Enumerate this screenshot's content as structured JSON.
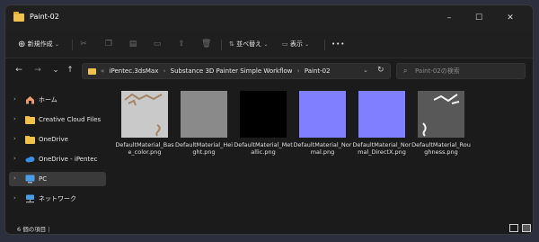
{
  "window": {
    "title": "Paint-02",
    "minimize": "–",
    "maximize": "☐",
    "close": "✕"
  },
  "toolbar": {
    "new_label": "新規作成",
    "new_icon": "⊕",
    "sort_label": "並べ替え",
    "view_label": "表示",
    "more_label": "•••",
    "dim_icons": [
      "cut-icon",
      "copy-icon",
      "paste-icon",
      "rename-icon",
      "share-icon",
      "delete-icon"
    ]
  },
  "nav": {
    "back": "←",
    "forward": "→",
    "dropdown": "⌄",
    "up": "↑"
  },
  "address": {
    "prefix": "«",
    "crumbs": [
      "iPentec.3dsMax",
      "Substance 3D Painter Simple Workflow",
      "Paint-02"
    ],
    "sep": "›",
    "dropdown": "⌄",
    "refresh": "↻"
  },
  "search": {
    "placeholder": "Paint-02の検索"
  },
  "sidebar": {
    "items": [
      {
        "label": "ホーム",
        "icon": "home-icon"
      },
      {
        "label": "Creative Cloud Files",
        "icon": "folder-icon"
      },
      {
        "label": "OneDrive",
        "icon": "folder-icon"
      },
      {
        "label": "OneDrive - iPentec",
        "icon": "cloud-icon"
      },
      {
        "label": "PC",
        "icon": "pc-icon"
      },
      {
        "label": "ネットワーク",
        "icon": "network-icon"
      }
    ]
  },
  "files": [
    {
      "name": "DefaultMaterial_Base_color.png",
      "color": "#c9c9c9"
    },
    {
      "name": "DefaultMaterial_Height.png",
      "color": "#8a8a8a"
    },
    {
      "name": "DefaultMaterial_Metallic.png",
      "color": "#000000"
    },
    {
      "name": "DefaultMaterial_Normal.png",
      "color": "#7f7fff"
    },
    {
      "name": "DefaultMaterial_Normal_DirectX.png",
      "color": "#7f7fff"
    },
    {
      "name": "DefaultMaterial_Roughness.png",
      "color": "#585858"
    }
  ],
  "status": {
    "text": "6 個の項目"
  },
  "colors": {
    "accent": "#4a90e2",
    "folder": "#f0c24b"
  }
}
